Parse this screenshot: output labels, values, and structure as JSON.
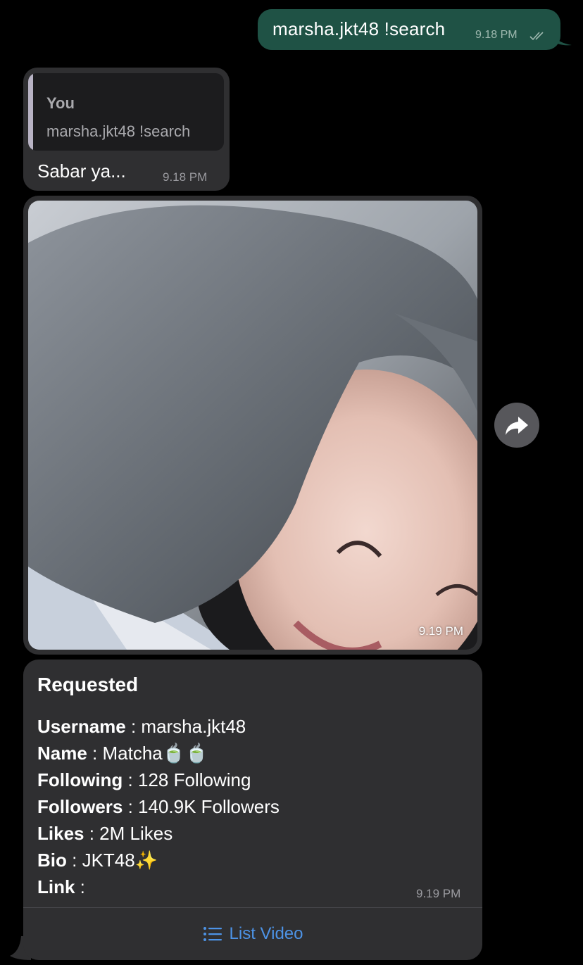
{
  "outgoing": {
    "text": "marsha.jkt48 !search",
    "time": "9.18 PM",
    "status_icon": "double-check-icon"
  },
  "reply": {
    "quote_author": "You",
    "quote_text": "marsha.jkt48 !search",
    "text": "Sabar ya...",
    "time": "9.18 PM"
  },
  "photo_message": {
    "time": "9.19 PM",
    "share_icon": "share-forward-icon"
  },
  "info_message": {
    "title": "Requested",
    "fields": [
      {
        "label": "Username",
        "sep": " : ",
        "value": "marsha.jkt48"
      },
      {
        "label": "Name",
        "sep": " : ",
        "value": "Matcha🍵🍵"
      },
      {
        "label": "Following",
        "sep": " : ",
        "value": "128 Following"
      },
      {
        "label": "Followers",
        "sep": " : ",
        "value": "140.9K Followers"
      },
      {
        "label": "Likes",
        "sep": " : ",
        "value": "2M Likes"
      },
      {
        "label": "Bio",
        "sep": " : ",
        "value": "JKT48✨"
      },
      {
        "label": "Link",
        "sep": " :",
        "value": ""
      }
    ],
    "time": "9.19 PM",
    "button_label": "List Video",
    "button_icon": "list-icon"
  },
  "colors": {
    "outgoing_bubble": "#1f5245",
    "incoming_bubble": "#2f2f31",
    "link_blue": "#4d93e6"
  }
}
